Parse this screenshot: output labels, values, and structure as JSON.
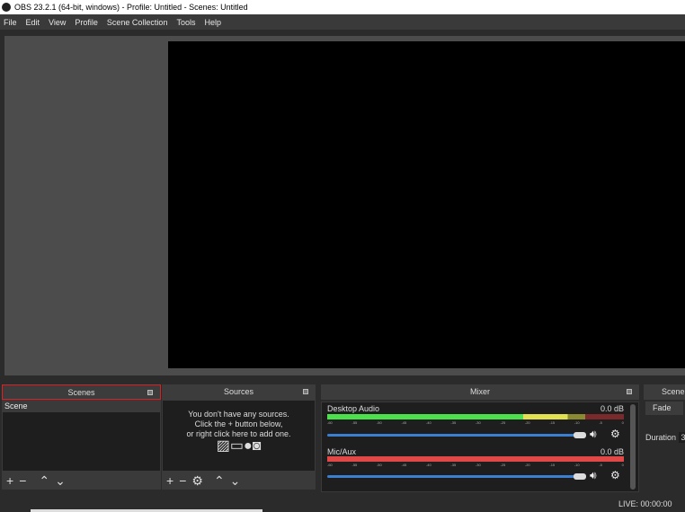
{
  "window": {
    "title": "OBS 23.2.1 (64-bit, windows) - Profile: Untitled - Scenes: Untitled"
  },
  "menu": [
    "File",
    "Edit",
    "View",
    "Profile",
    "Scene Collection",
    "Tools",
    "Help"
  ],
  "scenes": {
    "title": "Scenes",
    "items": [
      "Scene"
    ]
  },
  "sources": {
    "title": "Sources",
    "empty_lines": [
      "You don't have any sources.",
      "Click the + button below,",
      "or right click here to add one."
    ]
  },
  "mixer": {
    "title": "Mixer",
    "ticks": [
      "-60",
      "-55",
      "-50",
      "-45",
      "-40",
      "-35",
      "-30",
      "-25",
      "-20",
      "-15",
      "-10",
      "-5",
      "0"
    ],
    "channels": [
      {
        "name": "Desktop Audio",
        "level": "0.0 dB"
      },
      {
        "name": "Mic/Aux",
        "level": "0.0 dB"
      }
    ]
  },
  "transitions": {
    "title": "Scene",
    "type": "Fade",
    "duration_label": "Duration",
    "duration_value": "3"
  },
  "status": {
    "live": "LIVE: 00:00:00"
  }
}
